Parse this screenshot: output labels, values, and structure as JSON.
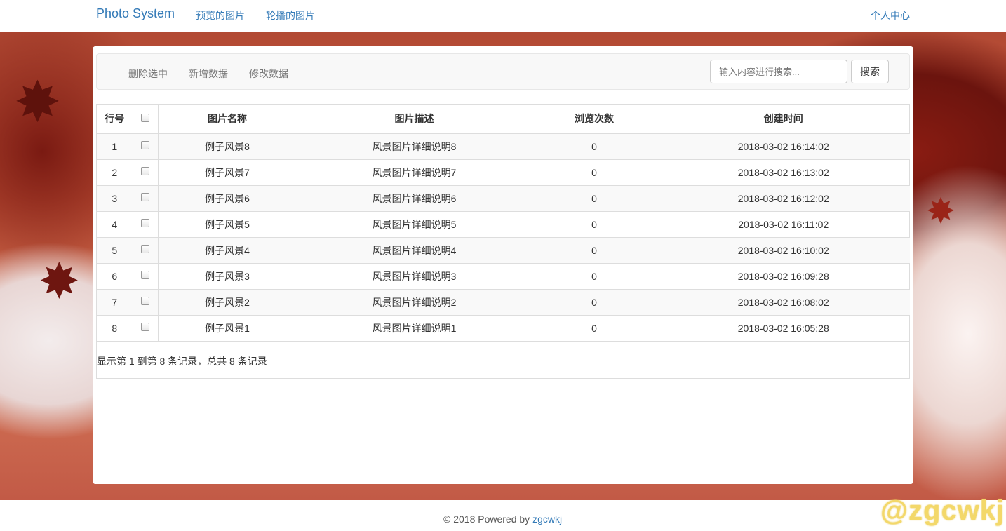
{
  "nav": {
    "brand": "Photo System",
    "links": [
      "预览的图片",
      "轮播的图片"
    ],
    "right": "个人中心"
  },
  "toolbar": {
    "actions": [
      "删除选中",
      "新增数据",
      "修改数据"
    ],
    "search_placeholder": "输入内容进行搜索...",
    "search_button": "搜索"
  },
  "table": {
    "headers": [
      "行号",
      "",
      "图片名称",
      "图片描述",
      "浏览次数",
      "创建时间"
    ],
    "rows": [
      {
        "no": "1",
        "name": "例子风景8",
        "desc": "风景图片详细说明8",
        "views": "0",
        "created": "2018-03-02 16:14:02"
      },
      {
        "no": "2",
        "name": "例子风景7",
        "desc": "风景图片详细说明7",
        "views": "0",
        "created": "2018-03-02 16:13:02"
      },
      {
        "no": "3",
        "name": "例子风景6",
        "desc": "风景图片详细说明6",
        "views": "0",
        "created": "2018-03-02 16:12:02"
      },
      {
        "no": "4",
        "name": "例子风景5",
        "desc": "风景图片详细说明5",
        "views": "0",
        "created": "2018-03-02 16:11:02"
      },
      {
        "no": "5",
        "name": "例子风景4",
        "desc": "风景图片详细说明4",
        "views": "0",
        "created": "2018-03-02 16:10:02"
      },
      {
        "no": "6",
        "name": "例子风景3",
        "desc": "风景图片详细说明3",
        "views": "0",
        "created": "2018-03-02 16:09:28"
      },
      {
        "no": "7",
        "name": "例子风景2",
        "desc": "风景图片详细说明2",
        "views": "0",
        "created": "2018-03-02 16:08:02"
      },
      {
        "no": "8",
        "name": "例子风景1",
        "desc": "风景图片详细说明1",
        "views": "0",
        "created": "2018-03-02 16:05:28"
      }
    ]
  },
  "pagination_text": "显示第 1 到第 8 条记录，总共 8 条记录",
  "footer": {
    "text": "© 2018 Powered by ",
    "link": "zgcwkj"
  },
  "watermark": "@zgcwkj",
  "colors": {
    "link": "#337ab7",
    "watermark": "#f3d86a"
  }
}
